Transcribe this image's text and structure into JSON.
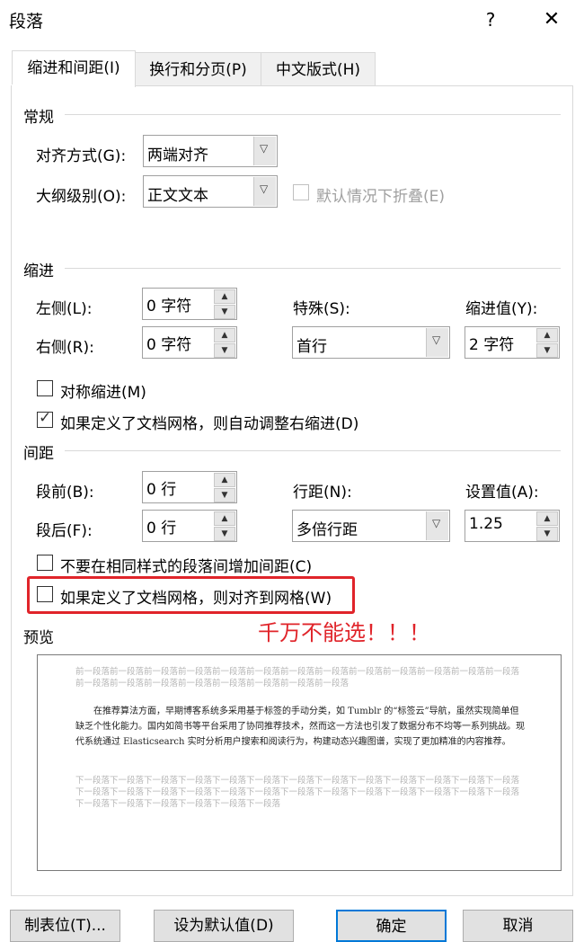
{
  "window": {
    "title": "段落",
    "help": "?",
    "close": "✕"
  },
  "tabs": [
    "缩进和间距(I)",
    "换行和分页(P)",
    "中文版式(H)"
  ],
  "general": {
    "heading": "常规",
    "alignment_label": "对齐方式(G):",
    "alignment_value": "两端对齐",
    "outline_label": "大纲级别(O):",
    "outline_value": "正文文本",
    "collapse_label": "默认情况下折叠(E)"
  },
  "indent": {
    "heading": "缩进",
    "left_label": "左侧(L):",
    "left_value": "0 字符",
    "right_label": "右侧(R):",
    "right_value": "0 字符",
    "special_label": "特殊(S):",
    "special_value": "首行",
    "by_label": "缩进值(Y):",
    "by_value": "2 字符",
    "mirror_label": "对称缩进(M)",
    "auto_adjust_label": "如果定义了文档网格，则自动调整右缩进(D)"
  },
  "spacing": {
    "heading": "间距",
    "before_label": "段前(B):",
    "before_value": "0 行",
    "after_label": "段后(F):",
    "after_value": "0 行",
    "line_label": "行距(N):",
    "line_value": "多倍行距",
    "at_label": "设置值(A):",
    "at_value": "1.25",
    "no_space_label": "不要在相同样式的段落间增加间距(C)",
    "snap_grid_label": "如果定义了文档网格，则对齐到网格(W)"
  },
  "annotation": "千万不能选！！！",
  "preview": {
    "heading": "预览",
    "before_text": "前一段落前一段落前一段落前一段落前一段落前一段落前一段落前一段落前一段落前一段落前一段落前一段落前一段落前一段落前一段落前一段落前一段落前一段落前一段落前一段落前一段落",
    "main_text": "在推荐算法方面，早期博客系统多采用基于标签的手动分类，如 Tumblr 的“标签云”导航，虽然实现简单但缺乏个性化能力。国内如简书等平台采用了协同推荐技术，然而这一方法也引发了数据分布不均等一系列挑战。现代系统通过 Elasticsearch 实时分析用户搜索和阅读行为，构建动态兴趣图谱，实现了更加精准的内容推荐。",
    "after_text": "下一段落下一段落下一段落下一段落下一段落下一段落下一段落下一段落下一段落下一段落下一段落下一段落下一段落下一段落下一段落下一段落下一段落下一段落下一段落下一段落下一段落下一段落下一段落下一段落下一段落下一段落下一段落下一段落下一段落下一段落下一段落下一段落"
  },
  "buttons": {
    "tabs": "制表位(T)...",
    "set_default": "设为默认值(D)",
    "ok": "确定",
    "cancel": "取消"
  }
}
